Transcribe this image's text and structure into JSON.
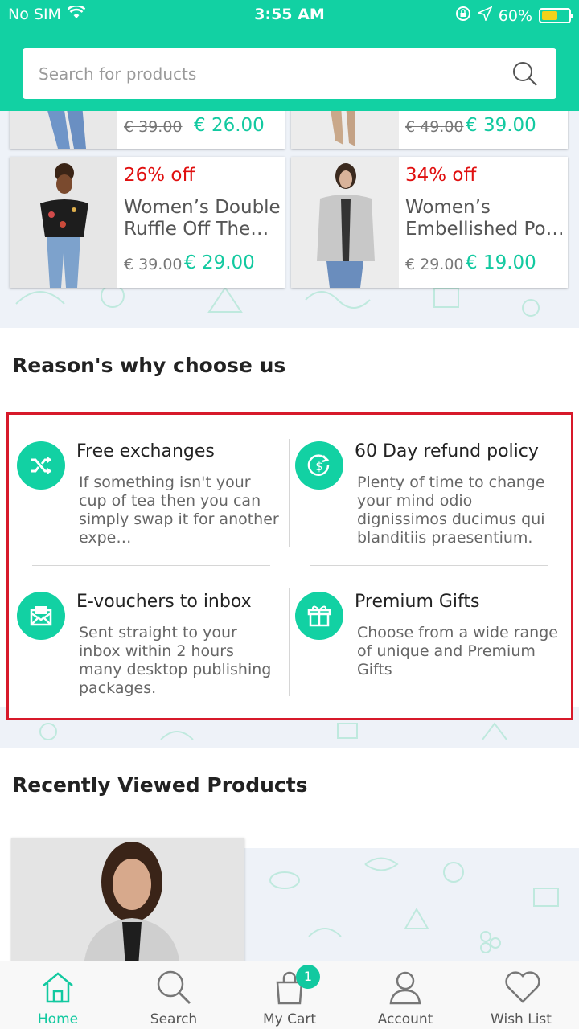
{
  "status_bar": {
    "carrier": "No SIM",
    "time": "3:55 AM",
    "battery": "60%"
  },
  "search": {
    "placeholder": "Search for products"
  },
  "products_top": [
    {
      "old_price": "€ 39.00",
      "new_price": "€ 26.00"
    },
    {
      "old_price": "€ 49.00",
      "new_price": "€ 39.00"
    }
  ],
  "products": [
    {
      "discount": "26% off",
      "name": "Women’s Double Ruffle Off The…",
      "old_price": "€ 39.00",
      "new_price": "€ 29.00"
    },
    {
      "discount": "34% off",
      "name": "Women’s Embellished Po…",
      "old_price": "€ 29.00",
      "new_price": "€ 19.00"
    }
  ],
  "reasons_title": "Reason's why choose us",
  "reasons": [
    {
      "icon": "shuffle-icon",
      "title": "Free exchanges",
      "desc": "If something isn't your cup of tea then you can simply swap it for another expe…"
    },
    {
      "icon": "refund-icon",
      "title": "60 Day refund policy",
      "desc": "Plenty of time to change your mind odio dignissimos ducimus qui blanditiis praesentium."
    },
    {
      "icon": "envelope-icon",
      "title": "E-vouchers to inbox",
      "desc": "Sent straight to your inbox within 2 hours many desktop publishing packages."
    },
    {
      "icon": "gift-icon",
      "title": "Premium Gifts",
      "desc": "Choose from a wide range of unique and Premium Gifts"
    }
  ],
  "recent_title": "Recently Viewed Products",
  "tabs": [
    {
      "label": "Home",
      "icon": "home-icon",
      "active": true
    },
    {
      "label": "Search",
      "icon": "search-icon",
      "active": false
    },
    {
      "label": "My Cart",
      "icon": "cart-icon",
      "active": false
    },
    {
      "label": "Account",
      "icon": "account-icon",
      "active": false
    },
    {
      "label": "Wish List",
      "icon": "heart-icon",
      "active": false
    }
  ],
  "cart_badge": "1",
  "colors": {
    "brand": "#12d1a3",
    "discount": "#e01010",
    "price": "#12c9a0",
    "highlight_border": "#d7192a"
  }
}
